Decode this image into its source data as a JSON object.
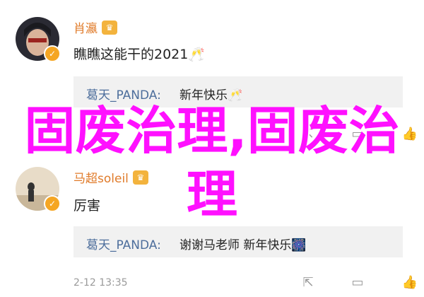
{
  "comments": [
    {
      "username": "肖瀛",
      "text": "瞧瞧这能干的2021🥂",
      "reply": {
        "user": "葛天_PANDA",
        "separator": ":",
        "text": "新年快乐🥂"
      },
      "time": "",
      "actions": {
        "share": "⇱",
        "comment": "💬",
        "like": "👍"
      }
    },
    {
      "username": "马超soleil",
      "text": "厉害",
      "reply": {
        "user": "葛天_PANDA",
        "separator": ":",
        "text": "谢谢马老师 新年快乐🎆"
      },
      "time": "2-12 13:35",
      "actions": {
        "share": "⇱",
        "comment": "💬",
        "like": "👍"
      }
    }
  ],
  "overlay": {
    "line1": "固废治理,固废治",
    "line2": "理"
  },
  "colors": {
    "username": "#e07b2a",
    "reply_user": "#4d6e9c",
    "overlay": "#ff10ff"
  }
}
